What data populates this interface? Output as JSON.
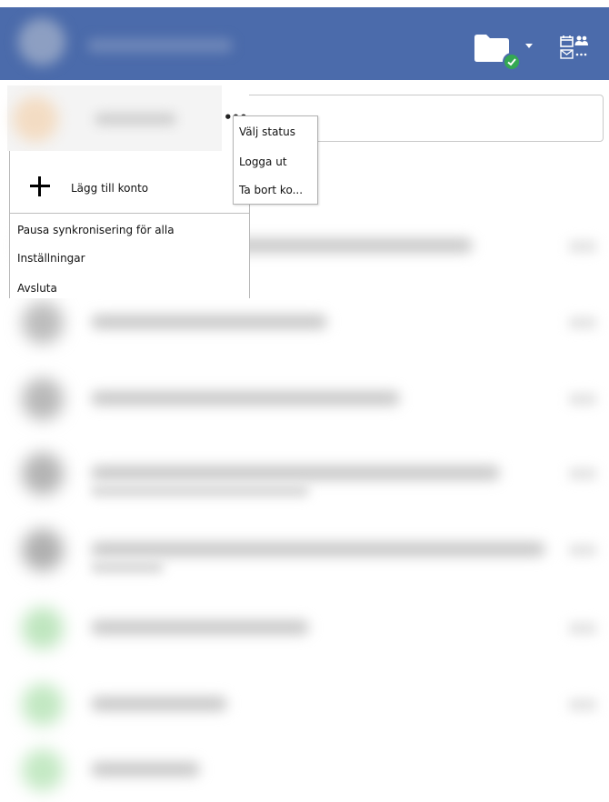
{
  "header": {
    "folder_icon": "folder-icon",
    "sync_status_icon": "check-circle-icon",
    "apps_icon": "calendar-contacts-mail-icon",
    "background_color": "#4b6bab"
  },
  "account_menu": {
    "more_button": "•••",
    "add_account_label": "Lägg till konto",
    "items": [
      "Pausa synkronisering för alla",
      "Inställningar",
      "Avsluta"
    ]
  },
  "context_menu": {
    "items": [
      "Välj status",
      "Logga ut",
      "Ta bort ko..."
    ]
  }
}
